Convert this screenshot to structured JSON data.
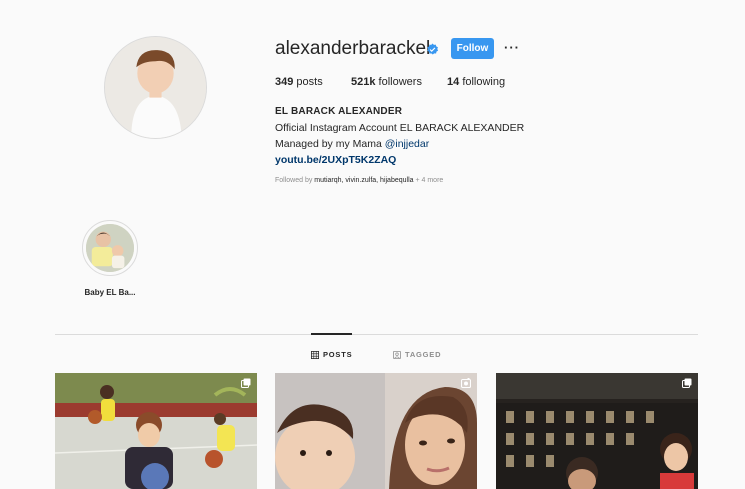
{
  "profile": {
    "username": "alexanderbarackel",
    "follow_label": "Follow",
    "more_label": "···",
    "stats": {
      "posts_count": "349",
      "posts_label": "posts",
      "followers_count": "521k",
      "followers_label": "followers",
      "following_count": "14",
      "following_label": "following"
    },
    "bio": {
      "name": "EL BARACK ALEXANDER",
      "line1": "Official Instagram Account EL BARACK ALEXANDER",
      "line2_prefix": "Managed by my Mama ",
      "line2_mention": "@injjedar",
      "website": "youtu.be/2UXpT5K2ZAQ"
    },
    "followed_by": {
      "prefix": "Followed by ",
      "names": "mutiarqh, vivin.zulfa, hijabequlla",
      "suffix": " + 4 more"
    }
  },
  "highlights": [
    {
      "label": "Baby EL Ba..."
    }
  ],
  "tabs": [
    {
      "label": "POSTS",
      "icon": "grid-icon",
      "active": true
    },
    {
      "label": "TAGGED",
      "icon": "tagged-icon",
      "active": false
    }
  ],
  "posts": [
    {
      "badge": "multiple-posts-icon"
    },
    {
      "badge": "igtv-icon"
    },
    {
      "badge": "multiple-posts-icon"
    }
  ],
  "colors": {
    "accent": "#3897f0",
    "link": "#00376b",
    "text": "#262626",
    "muted": "#8e8e8e",
    "background": "#fafafa"
  }
}
